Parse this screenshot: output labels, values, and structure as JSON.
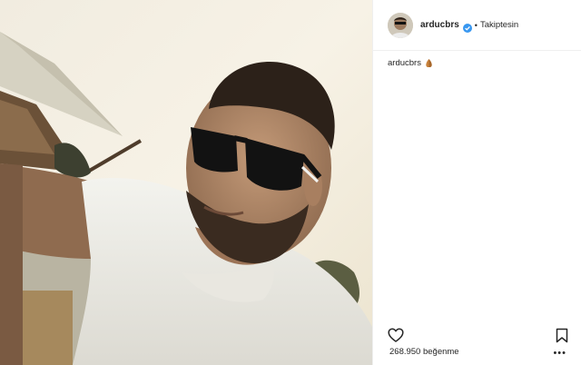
{
  "post": {
    "username": "arducbrs",
    "verified": true,
    "separator": "•",
    "follow_status": "Takiptesin",
    "caption": {
      "username": "arducbrs",
      "emoji": "folded-hands-emoji"
    },
    "likes_text": "268.950 beğenme",
    "more_label": "•••"
  },
  "icons": {
    "like": "heart-icon",
    "save": "bookmark-icon",
    "verified": "verified-badge-icon"
  },
  "colors": {
    "verified_blue": "#3897f0",
    "text": "#262626",
    "divider": "#efefef"
  }
}
